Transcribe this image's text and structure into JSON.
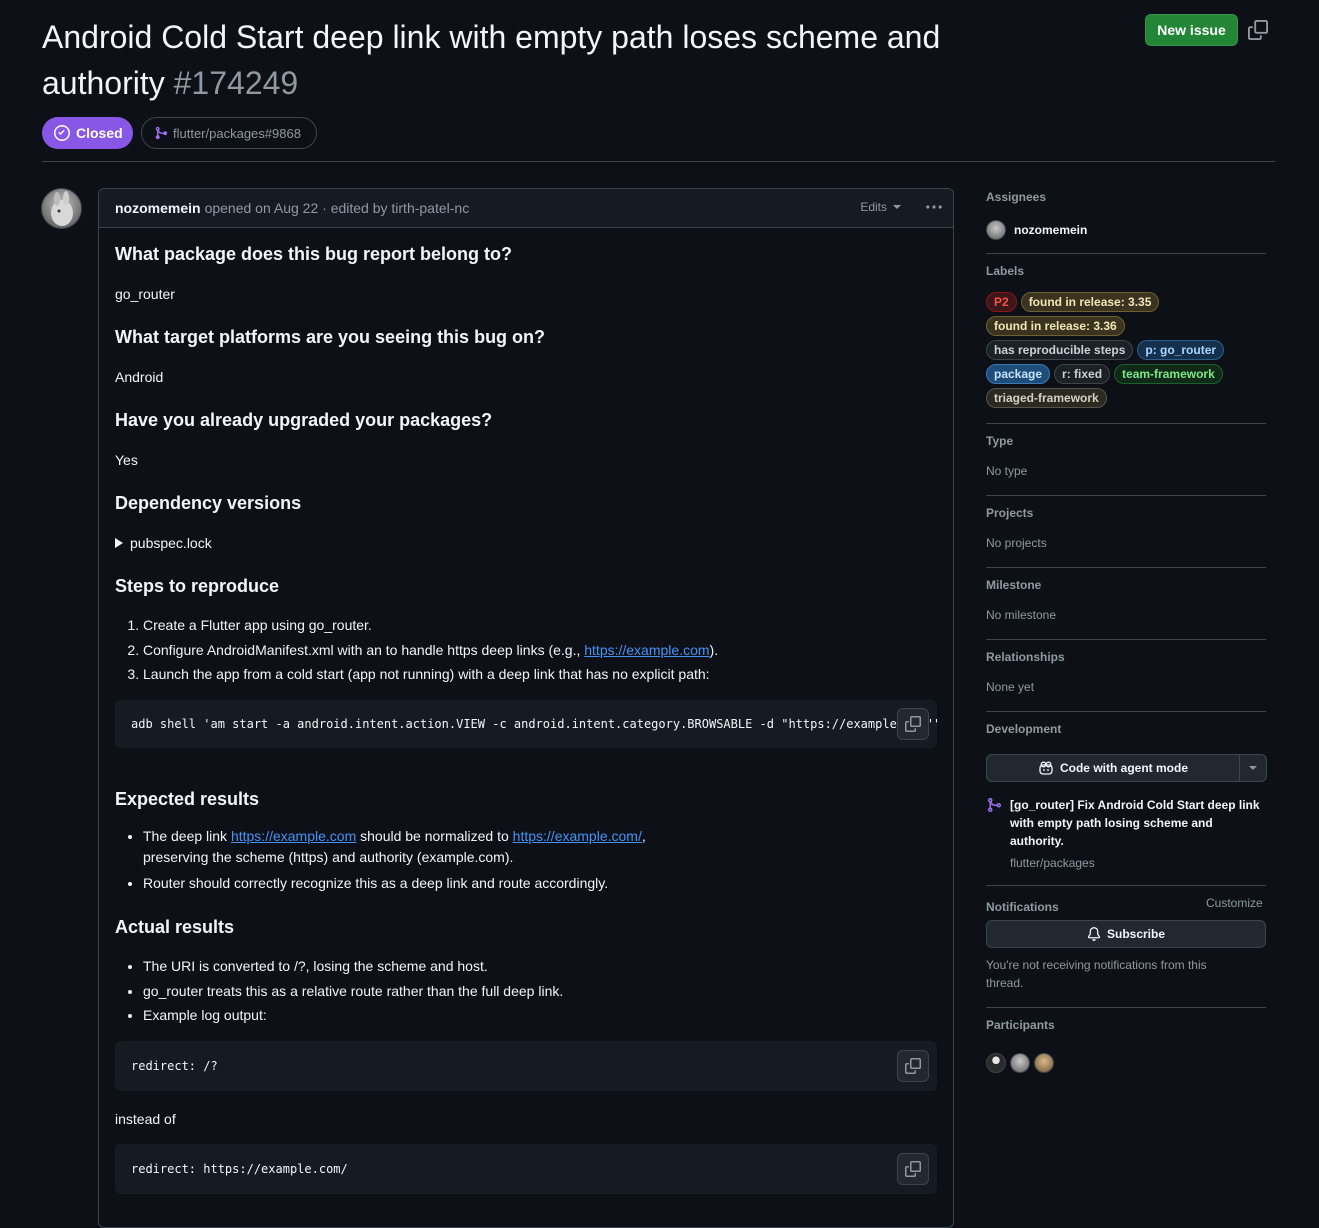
{
  "issue": {
    "title": "Android Cold Start deep link with empty path loses scheme and authority",
    "number": "#174249",
    "status": "Closed",
    "linked_pr": "flutter/packages#9868",
    "new_issue_label": "New issue"
  },
  "comment": {
    "author": "nozomemein",
    "meta": "opened on Aug 22 · edited by tirth-patel-nc",
    "edits_label": "Edits",
    "sections": {
      "package_q": "What package does this bug report belong to?",
      "package_a": "go_router",
      "platform_q": "What target platforms are you seeing this bug on?",
      "platform_a": "Android",
      "upgraded_q": "Have you already upgraded your packages?",
      "upgraded_a": "Yes",
      "deps_h": "Dependency versions",
      "deps_details": "pubspec.lock",
      "steps_h": "Steps to reproduce",
      "steps": [
        "Create a Flutter app using go_router.",
        "Configure AndroidManifest.xml with an to handle https deep links (e.g., ",
        "Launch the app from a cold start (app not running) with a deep link that has no explicit path:"
      ],
      "steps_link": "https://example.com",
      "steps_tail": ").",
      "code_adb": "adb shell 'am start -a android.intent.action.VIEW -c android.intent.category.BROWSABLE -d \"https://example.com\"'",
      "expected_h": "Expected results",
      "expected_1a": "The deep link ",
      "expected_link1": "https://example.com",
      "expected_1b": " should be normalized to ",
      "expected_link2": "https://example.com/",
      "expected_1c": ",",
      "expected_1d": "preserving the scheme (https) and authority (example.com).",
      "expected_2": "Router should correctly recognize this as a deep link and route accordingly.",
      "actual_h": "Actual results",
      "actual": [
        "The URI is converted to /?, losing the scheme and host.",
        "go_router treats this as a relative route rather than the full deep link.",
        "Example log output:"
      ],
      "code_redirect1": "redirect: /?",
      "instead_of": "instead of",
      "code_redirect2": "redirect: https://example.com/"
    }
  },
  "sidebar": {
    "assignees_h": "Assignees",
    "assignee": "nozomemein",
    "labels_h": "Labels",
    "labels": [
      {
        "text": "P2",
        "color": "#f85149",
        "bg": "#3c1618",
        "border": "#8e1519"
      },
      {
        "text": "found in release: 3.35",
        "color": "#f0e6b3",
        "bg": "#3a3320",
        "border": "#6e6030"
      },
      {
        "text": "found in release: 3.36",
        "color": "#f0e6b3",
        "bg": "#3a3320",
        "border": "#6e6030"
      },
      {
        "text": "has reproducible steps",
        "color": "#c9d1d9",
        "bg": "#1c2128",
        "border": "#3d444d"
      },
      {
        "text": "p: go_router",
        "color": "#a5d6ff",
        "bg": "#15304d",
        "border": "#2c5d8f"
      },
      {
        "text": "package",
        "color": "#c6e3ff",
        "bg": "#1f4d7a",
        "border": "#3a78b8"
      },
      {
        "text": "r: fixed",
        "color": "#c9d1d9",
        "bg": "#1c2128",
        "border": "#3d444d"
      },
      {
        "text": "team-framework",
        "color": "#7ee787",
        "bg": "#0f2a17",
        "border": "#1f5e2e"
      },
      {
        "text": "triaged-framework",
        "color": "#d2d2c0",
        "bg": "#2a2a22",
        "border": "#55554a"
      }
    ],
    "type_h": "Type",
    "type_v": "No type",
    "projects_h": "Projects",
    "projects_v": "No projects",
    "milestone_h": "Milestone",
    "milestone_v": "No milestone",
    "relationships_h": "Relationships",
    "relationships_v": "None yet",
    "development_h": "Development",
    "agent_button": "Code with agent mode",
    "pr_title": "[go_router] Fix Android Cold Start deep link with empty path losing scheme and authority.",
    "pr_repo": "flutter/packages",
    "notifications_h": "Notifications",
    "customize": "Customize",
    "subscribe": "Subscribe",
    "notif_text": "You're not receiving notifications from this thread.",
    "participants_h": "Participants"
  }
}
